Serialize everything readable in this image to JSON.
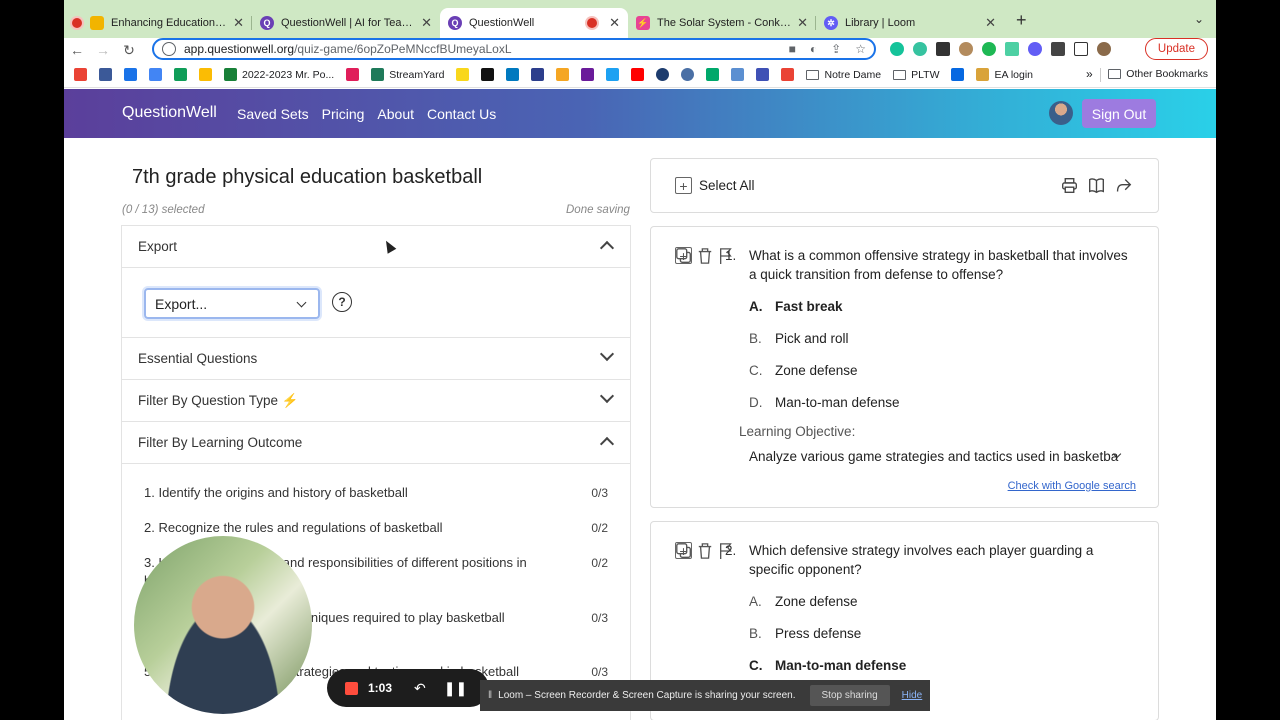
{
  "browser": {
    "tabs": [
      {
        "title": "Enhancing Education with AI: E",
        "fav_color": "#f2b400",
        "recording": true
      },
      {
        "title": "QuestionWell | AI for Teaching",
        "fav_color": "#6a3fb5",
        "recording": false
      },
      {
        "title": "QuestionWell",
        "fav_color": "#6a3fb5",
        "recording": false,
        "active": true
      },
      {
        "title": "The Solar System - Conker for",
        "fav_color": "#e84393",
        "recording": true
      },
      {
        "title": "Library | Loom",
        "fav_color": "#625df5",
        "recording": false
      }
    ],
    "url_host": "app.questionwell.org",
    "url_path": "/quiz-game/6opZoPeMNccfBUmeyaLoxL",
    "update_label": "Update",
    "bookmarks": [
      {
        "label": "2022-2023 Mr. Po...",
        "color": "#188038"
      },
      {
        "label": "StreamYard",
        "color": "#1f7a5a"
      }
    ],
    "bookmark_folders": [
      "Notre Dame",
      "PLTW"
    ],
    "ea_login": "EA login",
    "other_bookmarks": "Other Bookmarks"
  },
  "app": {
    "brand": "QuestionWell",
    "nav": [
      "Saved Sets",
      "Pricing",
      "About",
      "Contact Us"
    ],
    "sign_out": "Sign Out"
  },
  "left": {
    "title": "7th grade physical education basketball",
    "selected": "(0 / 13) selected",
    "save_status": "Done saving",
    "export_header": "Export",
    "export_select": "Export...",
    "essential_questions": "Essential Questions",
    "filter_type": "Filter By Question Type",
    "filter_type_icon": "⚡",
    "filter_outcome": "Filter By Learning Outcome",
    "outcomes": [
      {
        "text": "1. Identify the origins and history of basketball",
        "count": "0/3"
      },
      {
        "text": "2. Recognize the rules and regulations of basketball",
        "count": "0/2"
      },
      {
        "text": "3. Understand the roles and responsibilities of different positions in basketball",
        "count": "0/2"
      },
      {
        "text": "4. Learn basic skills and techniques required to play basketball",
        "count": "0/3"
      },
      {
        "text": "5. Analyze various game strategies and tactics used in basketball",
        "count": "0/3"
      }
    ]
  },
  "right": {
    "select_all": "Select All",
    "questions": [
      {
        "num": "1.",
        "text": "What is a common offensive strategy in basketball that involves a quick transition from defense to offense?",
        "options": [
          {
            "letter": "A.",
            "text": "Fast break",
            "correct": true
          },
          {
            "letter": "B.",
            "text": "Pick and roll",
            "correct": false
          },
          {
            "letter": "C.",
            "text": "Zone defense",
            "correct": false
          },
          {
            "letter": "D.",
            "text": "Man-to-man defense",
            "correct": false
          }
        ],
        "lo_label": "Learning Objective:",
        "lo_value": "Analyze various game strategies and tactics used in basketball",
        "google": "Check with Google search"
      },
      {
        "num": "2.",
        "text": "Which defensive strategy involves each player guarding a specific opponent?",
        "options": [
          {
            "letter": "A.",
            "text": "Zone defense",
            "correct": false
          },
          {
            "letter": "B.",
            "text": "Press defense",
            "correct": false
          },
          {
            "letter": "C.",
            "text": "Man-to-man defense",
            "correct": true
          }
        ]
      }
    ]
  },
  "loom": {
    "timer": "1:03",
    "share_text": "Loom – Screen Recorder & Screen Capture is sharing your screen.",
    "stop_sharing": "Stop sharing",
    "hide": "Hide"
  }
}
